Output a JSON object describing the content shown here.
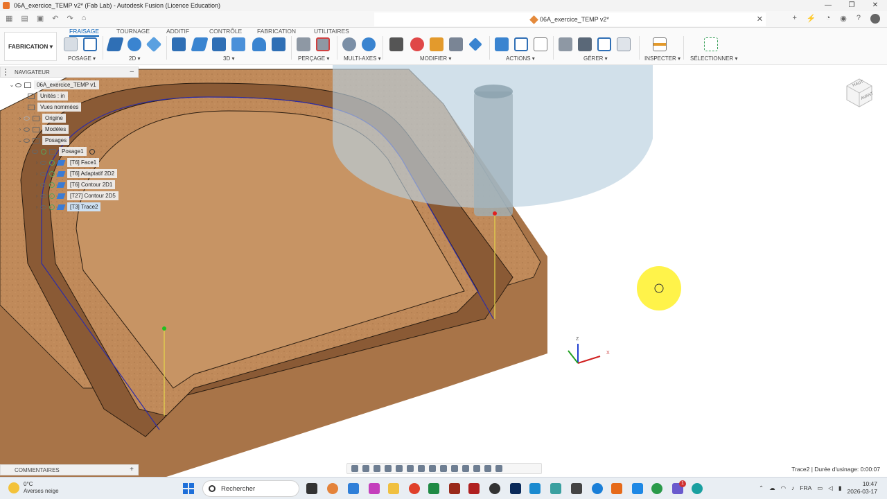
{
  "window": {
    "title": "06A_exercice_TEMP v2* (Fab Lab) - Autodesk Fusion (Licence Education)",
    "controls": [
      "—",
      "❐",
      "✕"
    ]
  },
  "doc_tab": {
    "title": "06A_exercice_TEMP v2*",
    "close": "✕"
  },
  "workspace": {
    "label": "FABRICATION",
    "arrow": "▾"
  },
  "ribbon_tabs": [
    {
      "label": "FRAISAGE",
      "active": true
    },
    {
      "label": "TOURNAGE"
    },
    {
      "label": "ADDITIF"
    },
    {
      "label": "CONTRÔLE"
    },
    {
      "label": "FABRICATION"
    },
    {
      "label": "UTILITAIRES"
    }
  ],
  "ribbon_groups": {
    "posage": "POSAGE ▾",
    "g2d": "2D ▾",
    "g3d": "3D ▾",
    "percage": "PERÇAGE ▾",
    "multiaxes": "MULTI-AXES ▾",
    "modifier": "MODIFIER ▾",
    "actions": "ACTIONS ▾",
    "gerer": "GÉRER ▾",
    "inspecter": "INSPECTER ▾",
    "selectionner": "SÉLECTIONNER ▾"
  },
  "navigator": {
    "title": "NAVIGATEUR",
    "collapse": "–",
    "root": "06A_exercice_TEMP v1",
    "units": "Unités : in",
    "named_views": "Vues nommées",
    "origin": "Origine",
    "models": "Modèles",
    "setups": "Posages",
    "setup1": "Posage1",
    "operations": [
      {
        "label": "[T6] Face1"
      },
      {
        "label": "[T6] Adaptatif 2D2"
      },
      {
        "label": "[T6] Contour 2D1"
      },
      {
        "label": "[T27] Contour 2D5"
      },
      {
        "label": "[T3] Trace2",
        "selected": true
      }
    ]
  },
  "viewcube": {
    "top": "HAUT",
    "front": "AVANT"
  },
  "axes": {
    "z": "Z",
    "x": "X"
  },
  "comments": {
    "title": "COMMENTAIRES",
    "add": "+"
  },
  "status": {
    "text": "Trace2 | Durée d'usinage: 0:00:07"
  },
  "taskbar": {
    "weather_temp": "0°C",
    "weather_desc": "Averses neige",
    "search_placeholder": "Rechercher",
    "language": "FRA",
    "time": "10:47",
    "date": "2026-03-17",
    "notification_count": "1"
  },
  "colors": {
    "accent": "#0a62b8",
    "wood": "#c08a5a",
    "tool_holder": "#b9d0de",
    "cursor_highlight": "#fff12a"
  }
}
